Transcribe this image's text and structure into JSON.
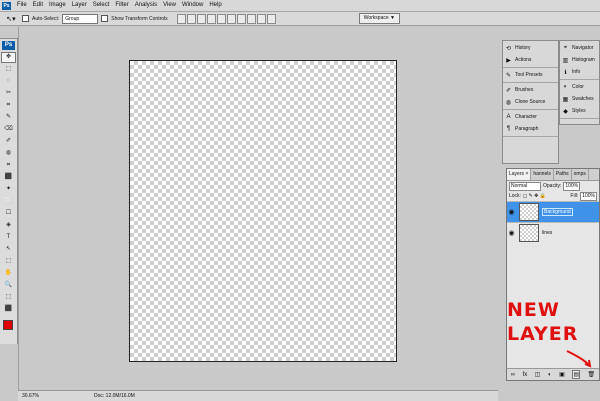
{
  "menu": {
    "logo": "Ps",
    "items": [
      "File",
      "Edit",
      "Image",
      "Layer",
      "Select",
      "Filter",
      "Analysis",
      "View",
      "Window",
      "Help"
    ]
  },
  "options_bar": {
    "auto_select_label": "Auto-Select:",
    "auto_select_value": "Group",
    "show_transform_label": "Show Transform Controls",
    "workspace_label": "Workspace ▼"
  },
  "toolbar": {
    "logo": "Ps",
    "tools": [
      "✥",
      "⬚",
      "◌",
      "✂",
      "⌗",
      "✎",
      "⌫",
      "✐",
      "◍",
      "⌗",
      "⬛",
      "✦",
      "⬜",
      "☐",
      "◈",
      "T",
      "↖",
      "⬚",
      "✋",
      "🔍",
      "⬚",
      "⬛"
    ],
    "foreground_color": "#e00000"
  },
  "status": {
    "zoom": "30.67%",
    "doc": "Doc: 12.0M/16.0M"
  },
  "panels_left": {
    "groups": [
      [
        {
          "label": "History",
          "icon": "history-icon"
        },
        {
          "label": "Actions",
          "icon": "actions-icon"
        }
      ],
      [
        {
          "label": "Tool Presets",
          "icon": "tool-presets-icon"
        }
      ],
      [
        {
          "label": "Brushes",
          "icon": "brushes-icon"
        },
        {
          "label": "Clone Source",
          "icon": "clone-source-icon"
        }
      ],
      [
        {
          "label": "Character",
          "icon": "character-icon"
        },
        {
          "label": "Paragraph",
          "icon": "paragraph-icon"
        }
      ]
    ]
  },
  "panels_right": {
    "groups": [
      [
        {
          "label": "Navigator",
          "icon": "navigator-icon"
        },
        {
          "label": "Histogram",
          "icon": "histogram-icon"
        },
        {
          "label": "Info",
          "icon": "info-icon"
        }
      ],
      [
        {
          "label": "Color",
          "icon": "color-icon"
        },
        {
          "label": "Swatches",
          "icon": "swatches-icon"
        },
        {
          "label": "Styles",
          "icon": "styles-icon"
        }
      ]
    ]
  },
  "layers": {
    "tabs": [
      "Layers ×",
      "hannels",
      "Paths",
      "omps"
    ],
    "blend_mode": "Normal",
    "opacity_label": "Opacity:",
    "opacity_value": "100%",
    "lock_label": "Lock:",
    "fill_label": "Fill:",
    "fill_value": "100%",
    "rows": [
      {
        "name": "Background",
        "selected": true
      },
      {
        "name": "lines",
        "selected": false
      }
    ]
  },
  "annotation": {
    "line1": "NEW",
    "line2": "LAYER",
    "color": "#e01010"
  }
}
